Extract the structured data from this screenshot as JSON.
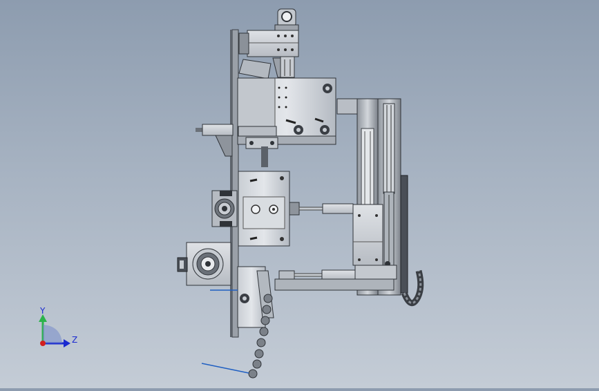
{
  "viewport": {
    "background_top": "#8d9caf",
    "background_bottom": "#c4ccd6"
  },
  "triad": {
    "y_label": "Y",
    "z_label": "Z",
    "y_color": "#2bb34a",
    "z_color": "#1a2ad0",
    "x_color": "#d21f1f"
  },
  "model": {
    "steel_light": "#d7dbe0",
    "steel_mid": "#a9afb7",
    "steel_dark": "#4a4f57",
    "shadow": "#2a2d33",
    "accent_wire": "#1f5fc2"
  }
}
